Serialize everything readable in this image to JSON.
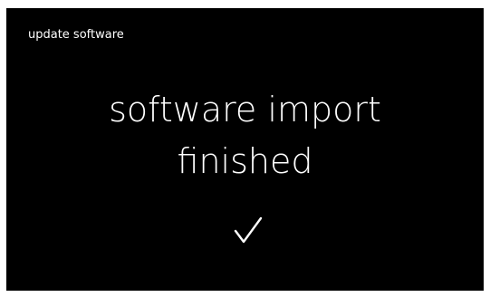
{
  "header": {
    "title": "update software"
  },
  "status": {
    "message_line_1": "software import",
    "message_line_2": "finished",
    "icon": "checkmark-icon"
  },
  "colors": {
    "background": "#000000",
    "foreground": "#ffffff"
  }
}
